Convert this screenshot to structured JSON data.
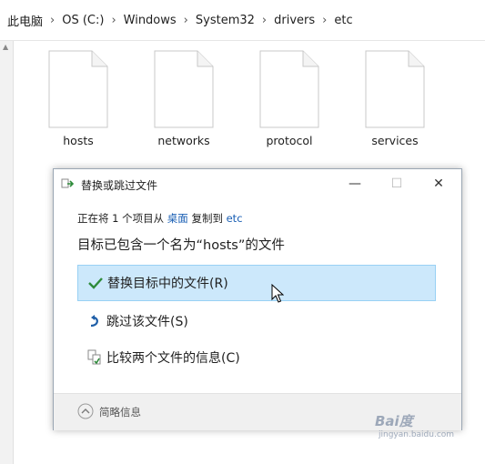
{
  "breadcrumb": {
    "items": [
      "此电脑",
      "OS (C:)",
      "Windows",
      "System32",
      "drivers",
      "etc"
    ],
    "separator": "›"
  },
  "files": [
    {
      "name": "hosts"
    },
    {
      "name": "networks"
    },
    {
      "name": "protocol"
    },
    {
      "name": "services"
    }
  ],
  "dialog": {
    "title": "替换或跳过文件",
    "minimize_glyph": "—",
    "maximize_glyph": "☐",
    "close_glyph": "✕",
    "status": {
      "prefix": "正在将 1 个项目从",
      "source": "桌面",
      "middle": "复制到",
      "destination": "etc"
    },
    "heading": "目标已包含一个名为“hosts”的文件",
    "options": [
      {
        "label": "替换目标中的文件(R)",
        "icon": "checkmark-icon",
        "selected": true
      },
      {
        "label": "跳过该文件(S)",
        "icon": "skip-arrow-icon",
        "selected": false
      },
      {
        "label": "比较两个文件的信息(C)",
        "icon": "compare-files-icon",
        "selected": false
      }
    ],
    "footer": {
      "label": "简略信息",
      "icon": "chevron-up-circle-icon"
    }
  },
  "watermark": {
    "text": "Bai度",
    "sub": "jingyan.baidu.com"
  },
  "colors": {
    "selection_bg": "#cce8fb",
    "selection_border": "#99d1f4",
    "link": "#1a5fb4",
    "check": "#2e8b3a",
    "skip_icon": "#1f5fa8"
  }
}
